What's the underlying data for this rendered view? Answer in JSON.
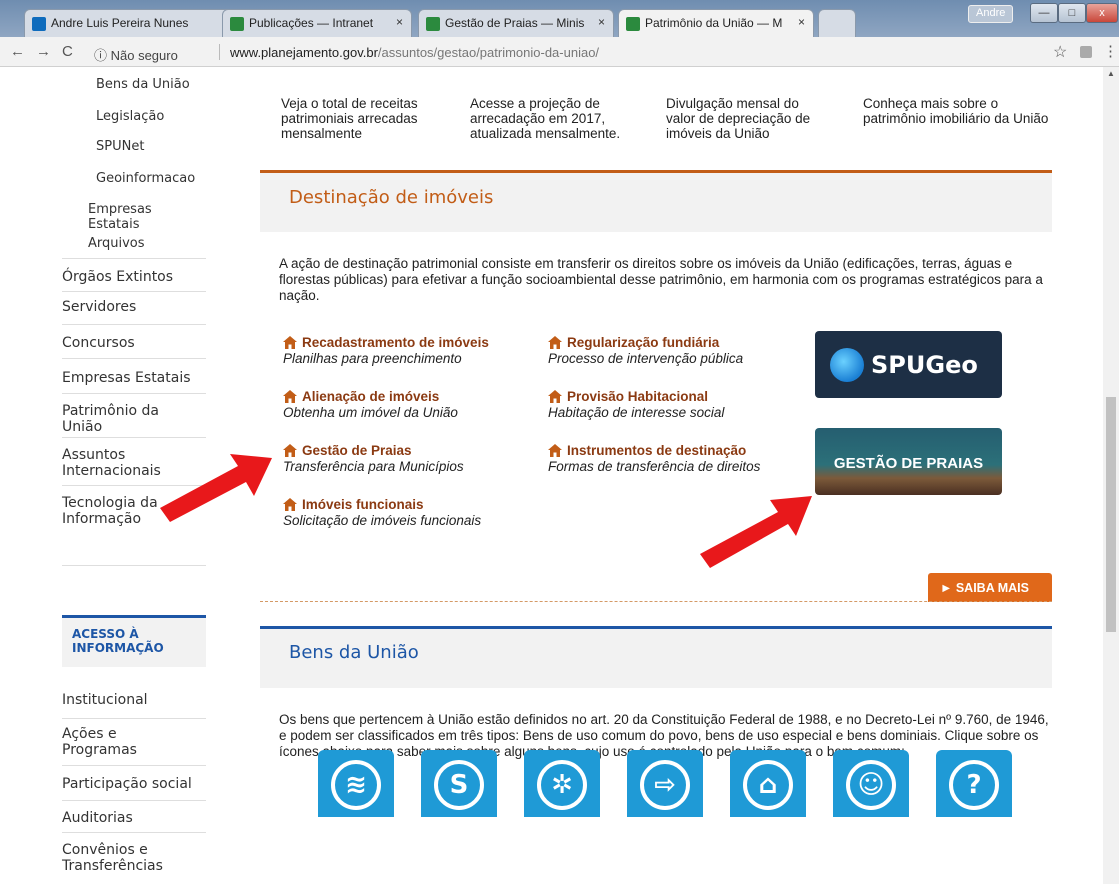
{
  "browser": {
    "tabs": [
      {
        "label": "Andre Luis Pereira Nunes",
        "close": "×"
      },
      {
        "label": "Publicações — Intranet",
        "close": "×"
      },
      {
        "label": "Gestão de Praias — Minis",
        "close": "×"
      },
      {
        "label": "Patrimônio da União — M",
        "close": "×"
      }
    ],
    "user": "Andre",
    "security": "ⓘ Não seguro",
    "url_host": "www.planejamento.gov.br",
    "url_path": "/assuntos/gestao/patrimonio-da-uniao/"
  },
  "sidebar": {
    "items": [
      "Bens da União",
      "Legislação",
      "SPUNet",
      "Geoinformacao",
      "Empresas Estatais",
      "Arquivos",
      "Órgãos Extintos",
      "Servidores",
      "Concursos",
      "Empresas Estatais",
      "Patrimônio da União",
      "Assuntos Internacionais",
      "Tecnologia da Informação"
    ],
    "acesso_title": "ACESSO À INFORMAÇÃO",
    "acesso_items": [
      "Institucional",
      "Ações e Programas",
      "Participação social",
      "Auditorias",
      "Convênios e Transferências"
    ]
  },
  "main": {
    "top_blurbs": [
      "Veja o total de receitas patrimoniais arrecadas mensalmente",
      "Acesse a projeção de arrecadação em 2017, atualizada mensalmente.",
      "Divulgação mensal do valor de depreciação de imóveis da União",
      "Conheça mais sobre o patrimônio imobiliário da União"
    ],
    "destinacao": {
      "title": "Destinação de imóveis",
      "intro": "A ação de destinação patrimonial consiste em transferir os direitos sobre os imóveis da União (edificações, terras, águas e florestas públicas) para efetivar a função socioambiental desse patrimônio, em harmonia com os programas estratégicos para a nação.",
      "links": [
        {
          "title": "Recadastramento de imóveis",
          "desc": "Planilhas para preenchimento"
        },
        {
          "title": "Alienação de imóveis",
          "desc": "Obtenha um imóvel da União"
        },
        {
          "title": "Gestão de Praias",
          "desc": "Transferência para Municípios"
        },
        {
          "title": "Imóveis funcionais",
          "desc": "Solicitação de imóveis funcionais"
        },
        {
          "title": "Regularização fundiária",
          "desc": "Processo de intervenção pública"
        },
        {
          "title": "Provisão Habitacional",
          "desc": "Habitação de interesse social"
        },
        {
          "title": "Instrumentos de destinação",
          "desc": "Formas de transferência de direitos"
        }
      ],
      "spugeo_label": "SPUGeo",
      "praias_label": "GESTÃO DE PRAIAS",
      "saiba_mais": "► SAIBA MAIS"
    },
    "bens": {
      "title": "Bens da União",
      "intro": "Os bens que pertencem à União estão definidos no art. 20 da Constituição Federal de 1988, e no Decreto-Lei nº 9.760, de 1946, e podem ser classificados em três tipos: Bens de uso comum do povo, bens de uso especial e bens dominiais. Clique sobre os ícones abaixo para saber mais sobre alguns bens, cujo uso é controlado pela União para o bem comum:"
    },
    "bens_icons": [
      "water-icon",
      "river-icon",
      "island-icon",
      "coast-sign-icon",
      "land-icon",
      "indigenous-icon",
      "question-icon"
    ]
  },
  "colors": {
    "accent_blue": "#1d56a6",
    "link_brown": "#8b3a12",
    "orange": "#e0681a",
    "arrow_red": "#e8181b",
    "icon_blue": "#1f9ad6"
  }
}
